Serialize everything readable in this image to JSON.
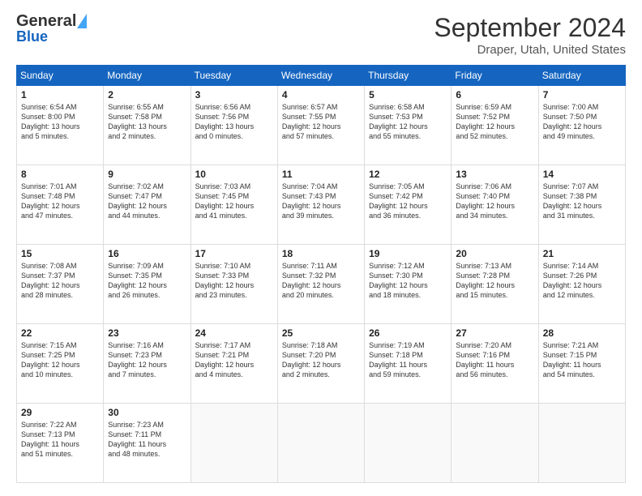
{
  "logo": {
    "line1": "General",
    "line2": "Blue"
  },
  "title": "September 2024",
  "subtitle": "Draper, Utah, United States",
  "days_of_week": [
    "Sunday",
    "Monday",
    "Tuesday",
    "Wednesday",
    "Thursday",
    "Friday",
    "Saturday"
  ],
  "weeks": [
    [
      {
        "day": "1",
        "info": "Sunrise: 6:54 AM\nSunset: 8:00 PM\nDaylight: 13 hours\nand 5 minutes."
      },
      {
        "day": "2",
        "info": "Sunrise: 6:55 AM\nSunset: 7:58 PM\nDaylight: 13 hours\nand 2 minutes."
      },
      {
        "day": "3",
        "info": "Sunrise: 6:56 AM\nSunset: 7:56 PM\nDaylight: 13 hours\nand 0 minutes."
      },
      {
        "day": "4",
        "info": "Sunrise: 6:57 AM\nSunset: 7:55 PM\nDaylight: 12 hours\nand 57 minutes."
      },
      {
        "day": "5",
        "info": "Sunrise: 6:58 AM\nSunset: 7:53 PM\nDaylight: 12 hours\nand 55 minutes."
      },
      {
        "day": "6",
        "info": "Sunrise: 6:59 AM\nSunset: 7:52 PM\nDaylight: 12 hours\nand 52 minutes."
      },
      {
        "day": "7",
        "info": "Sunrise: 7:00 AM\nSunset: 7:50 PM\nDaylight: 12 hours\nand 49 minutes."
      }
    ],
    [
      {
        "day": "8",
        "info": "Sunrise: 7:01 AM\nSunset: 7:48 PM\nDaylight: 12 hours\nand 47 minutes."
      },
      {
        "day": "9",
        "info": "Sunrise: 7:02 AM\nSunset: 7:47 PM\nDaylight: 12 hours\nand 44 minutes."
      },
      {
        "day": "10",
        "info": "Sunrise: 7:03 AM\nSunset: 7:45 PM\nDaylight: 12 hours\nand 41 minutes."
      },
      {
        "day": "11",
        "info": "Sunrise: 7:04 AM\nSunset: 7:43 PM\nDaylight: 12 hours\nand 39 minutes."
      },
      {
        "day": "12",
        "info": "Sunrise: 7:05 AM\nSunset: 7:42 PM\nDaylight: 12 hours\nand 36 minutes."
      },
      {
        "day": "13",
        "info": "Sunrise: 7:06 AM\nSunset: 7:40 PM\nDaylight: 12 hours\nand 34 minutes."
      },
      {
        "day": "14",
        "info": "Sunrise: 7:07 AM\nSunset: 7:38 PM\nDaylight: 12 hours\nand 31 minutes."
      }
    ],
    [
      {
        "day": "15",
        "info": "Sunrise: 7:08 AM\nSunset: 7:37 PM\nDaylight: 12 hours\nand 28 minutes."
      },
      {
        "day": "16",
        "info": "Sunrise: 7:09 AM\nSunset: 7:35 PM\nDaylight: 12 hours\nand 26 minutes."
      },
      {
        "day": "17",
        "info": "Sunrise: 7:10 AM\nSunset: 7:33 PM\nDaylight: 12 hours\nand 23 minutes."
      },
      {
        "day": "18",
        "info": "Sunrise: 7:11 AM\nSunset: 7:32 PM\nDaylight: 12 hours\nand 20 minutes."
      },
      {
        "day": "19",
        "info": "Sunrise: 7:12 AM\nSunset: 7:30 PM\nDaylight: 12 hours\nand 18 minutes."
      },
      {
        "day": "20",
        "info": "Sunrise: 7:13 AM\nSunset: 7:28 PM\nDaylight: 12 hours\nand 15 minutes."
      },
      {
        "day": "21",
        "info": "Sunrise: 7:14 AM\nSunset: 7:26 PM\nDaylight: 12 hours\nand 12 minutes."
      }
    ],
    [
      {
        "day": "22",
        "info": "Sunrise: 7:15 AM\nSunset: 7:25 PM\nDaylight: 12 hours\nand 10 minutes."
      },
      {
        "day": "23",
        "info": "Sunrise: 7:16 AM\nSunset: 7:23 PM\nDaylight: 12 hours\nand 7 minutes."
      },
      {
        "day": "24",
        "info": "Sunrise: 7:17 AM\nSunset: 7:21 PM\nDaylight: 12 hours\nand 4 minutes."
      },
      {
        "day": "25",
        "info": "Sunrise: 7:18 AM\nSunset: 7:20 PM\nDaylight: 12 hours\nand 2 minutes."
      },
      {
        "day": "26",
        "info": "Sunrise: 7:19 AM\nSunset: 7:18 PM\nDaylight: 11 hours\nand 59 minutes."
      },
      {
        "day": "27",
        "info": "Sunrise: 7:20 AM\nSunset: 7:16 PM\nDaylight: 11 hours\nand 56 minutes."
      },
      {
        "day": "28",
        "info": "Sunrise: 7:21 AM\nSunset: 7:15 PM\nDaylight: 11 hours\nand 54 minutes."
      }
    ],
    [
      {
        "day": "29",
        "info": "Sunrise: 7:22 AM\nSunset: 7:13 PM\nDaylight: 11 hours\nand 51 minutes."
      },
      {
        "day": "30",
        "info": "Sunrise: 7:23 AM\nSunset: 7:11 PM\nDaylight: 11 hours\nand 48 minutes."
      },
      null,
      null,
      null,
      null,
      null
    ]
  ]
}
